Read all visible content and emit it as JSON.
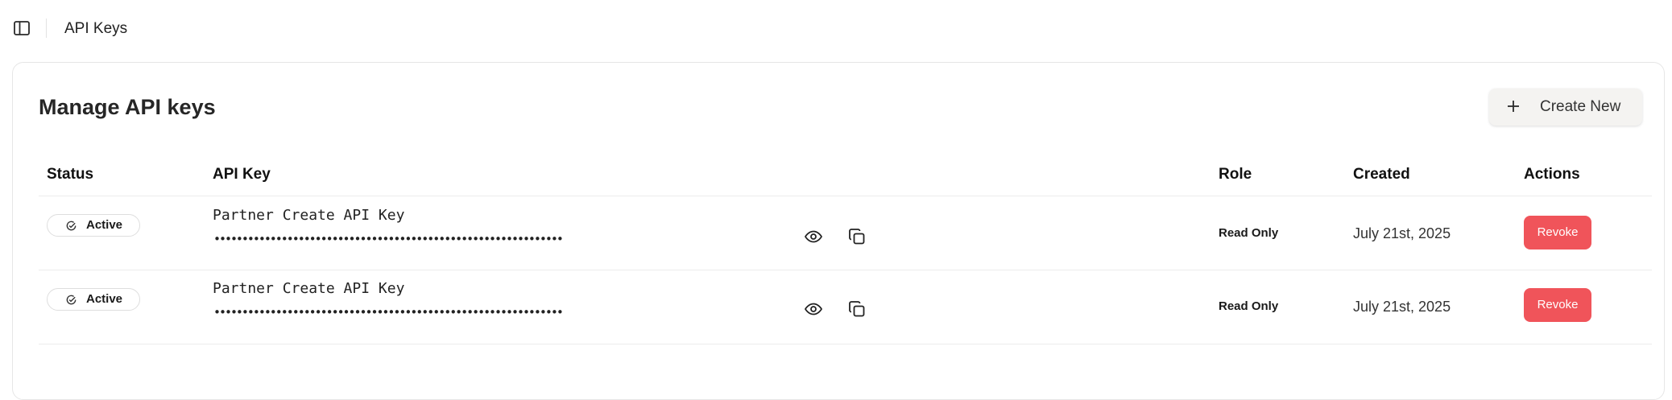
{
  "header": {
    "breadcrumb": "API Keys"
  },
  "card": {
    "title": "Manage API keys",
    "create_button_label": "Create New"
  },
  "table": {
    "columns": {
      "status": "Status",
      "api_key": "API Key",
      "role": "Role",
      "created": "Created",
      "actions": "Actions"
    },
    "rows": [
      {
        "status": "Active",
        "key_name": "Partner Create API Key",
        "key_mask": "••••••••••••••••••••••••••••••••••••••••••••••••••••••••••••••",
        "role": "Read Only",
        "created": "July 21st, 2025",
        "action": "Revoke"
      },
      {
        "status": "Active",
        "key_name": "Partner Create API Key",
        "key_mask": "••••••••••••••••••••••••••••••••••••••••••••••••••••••••••••••",
        "role": "Read Only",
        "created": "July 21st, 2025",
        "action": "Revoke"
      }
    ]
  },
  "colors": {
    "accent_danger": "#f0545a",
    "button_bg": "#f4f3f1",
    "border": "#e6e6e6"
  },
  "icons": {
    "sidebar_toggle": "sidebar-toggle-icon",
    "create": "plus-icon",
    "status": "check-circle-icon",
    "reveal": "eye-icon",
    "copy": "copy-icon"
  }
}
